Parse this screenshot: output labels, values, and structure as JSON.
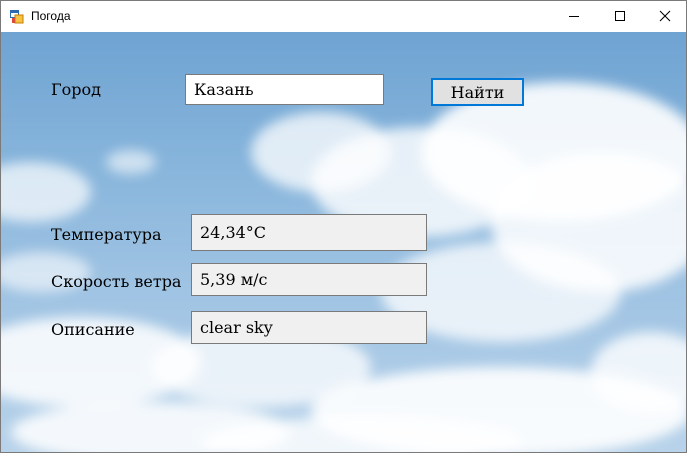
{
  "window": {
    "title": "Погода",
    "icon": "windows-form-icon",
    "controls": [
      "minimize-icon",
      "maximize-icon",
      "close-icon"
    ]
  },
  "form": {
    "city_label": "Город",
    "city_value": "Казань",
    "search_button": "Найти",
    "temperature_label": "Температура",
    "temperature_value": "24,34°C",
    "wind_label": "Скорость ветра",
    "wind_value": "5,39 м/с",
    "description_label": "Описание",
    "description_value": "clear sky"
  },
  "colors": {
    "accent": "#0078d7",
    "sky": "#86b4db"
  }
}
